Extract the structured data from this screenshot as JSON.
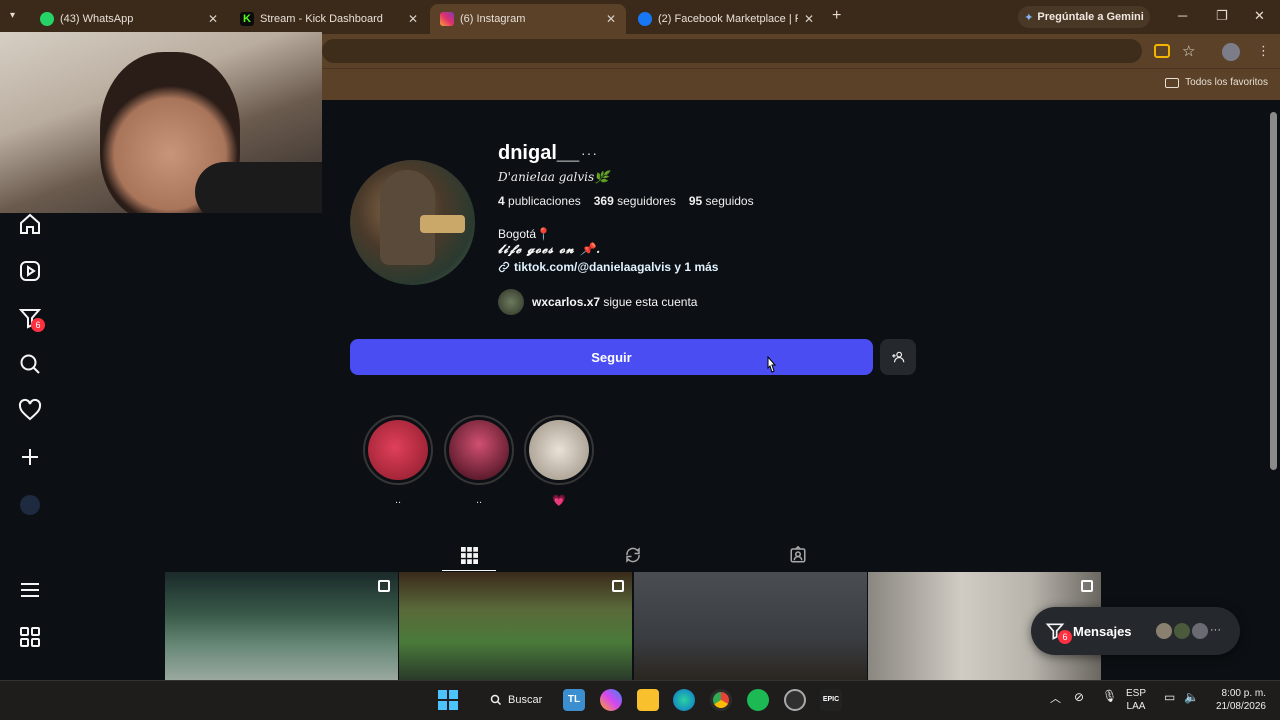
{
  "browser": {
    "tabs": [
      {
        "title": "(43) WhatsApp",
        "icon": "whatsapp-icon",
        "color": "#25d366"
      },
      {
        "title": "Stream - Kick Dashboard",
        "icon": "kick-icon",
        "color": "#53fc18"
      },
      {
        "title": "(6) Instagram",
        "icon": "instagram-icon",
        "color": "#e1306c",
        "active": true
      },
      {
        "title": "(2) Facebook Marketplace | Face",
        "icon": "facebook-icon",
        "color": "#1877f2"
      }
    ],
    "gemini_label": "Pregúntale a Gemini",
    "bookmarks_folder": "Todos los favoritos"
  },
  "profile": {
    "username": "dnigal__",
    "more": "···",
    "full_name": "D'anielaa galvis🌿",
    "posts_count": "4",
    "posts_label": "publicaciones",
    "followers_count": "369",
    "followers_label": "seguidores",
    "following_count": "95",
    "following_label": "seguidos",
    "bio_line1": "Bogotá📍",
    "bio_line2": "𝓵𝓲𝓯𝓮 𝓰𝓸𝓮𝓼 𝓸𝓷 📌.",
    "link_text": "tiktok.com/@danielaagalvis y 1 más",
    "followed_by_user": "wxcarlos.x7",
    "followed_by_text": "sigue esta cuenta",
    "follow_button": "Seguir"
  },
  "highlights": [
    {
      "label": "..",
      "color": "#b8213a"
    },
    {
      "label": "..",
      "color": "#7a1a2a"
    },
    {
      "label": "💗",
      "color": "#8a8a80"
    }
  ],
  "messages": {
    "label": "Mensajes",
    "badge": "6",
    "more": "···"
  },
  "nav": {
    "notifications_badge": "6"
  },
  "taskbar": {
    "search_label": "Buscar",
    "lang_line1": "ESP",
    "lang_line2": "LAA",
    "time": "8:00 p. m.",
    "date": "21/08/2026"
  }
}
